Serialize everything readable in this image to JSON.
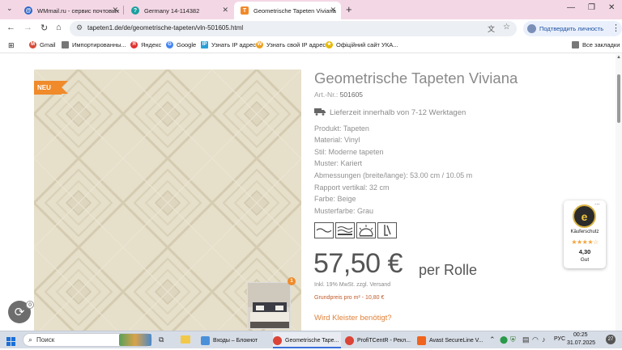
{
  "browser": {
    "tabs": [
      {
        "title": "WMmail.ru - сервис почтовых",
        "favicon_color": "#2a66c9",
        "active": false
      },
      {
        "title": "Germany 14-114382",
        "favicon_color": "#1aa0a0",
        "active": false
      },
      {
        "title": "Geometrische Tapeten Viviana",
        "favicon_color": "#f08a2a",
        "active": true
      }
    ],
    "new_tab_label": "+",
    "url": "tapeten1.de/de/geometrische-tapeten/vln-501605.html",
    "profile_chip": "Подтвердить личность",
    "bookmarks": [
      {
        "label": "Gmail",
        "color": "#d64a3a"
      },
      {
        "label": "Импортированны...",
        "color": "#777777"
      },
      {
        "label": "Яндекс",
        "color": "#e0322f"
      },
      {
        "label": "Google",
        "color": "#4285f4"
      },
      {
        "label": "Узнать IP адрес",
        "color": "#2a9fd6"
      },
      {
        "label": "Узнать свой IP адрес",
        "color": "#f0a020"
      },
      {
        "label": "Офіційний сайт УКА...",
        "color": "#e6b800"
      }
    ],
    "all_bookmarks": "Все закладки"
  },
  "product": {
    "badge": "NEU",
    "title": "Geometrische Tapeten Viviana",
    "art_label": "Art.-Nr.:",
    "art_value": "501605",
    "delivery": "Lieferzeit innerhalb von 7-12 Werktagen",
    "specs": [
      "Produkt: Tapeten",
      "Material: Vinyl",
      "Stil: Moderne tapeten",
      "Muster: Kariert",
      "Abmessungen (breite/lange): 53.00 cm / 10.05 m",
      "Rapport vertikal: 32 cm",
      "Farbe: Beige",
      "Musterfarbe: Grau"
    ],
    "feature_icons": [
      "wave-icon",
      "water-resistant-icon",
      "light-fastness-icon",
      "paste-wall-icon"
    ],
    "price": "57,50 €",
    "per_unit": "per Rolle",
    "vat_note": "Inkl. 19% MwSt. zzgl. Versand",
    "base_price": "Grundpreis pro m² - 10,80 €",
    "paste_link": "Wird Kleister benötigt?",
    "thumb_badge": "1"
  },
  "trust_badge": {
    "seal": "e",
    "label": "Käuferschutz",
    "stars": "★★★★☆",
    "score": "4,30",
    "rating_word": "Gut",
    "more": "..."
  },
  "floating": {
    "count": "0"
  },
  "taskbar": {
    "search_placeholder": "Поиск",
    "items": [
      {
        "label": "Входы – Блокнот",
        "color": "#4a90d9"
      },
      {
        "label": "Geometrische Tape...",
        "color": "#db4437"
      },
      {
        "label": "ProfiTCentR - Рекл...",
        "color": "#db4437"
      },
      {
        "label": "Avast SecureLine V...",
        "color": "#f0641e"
      }
    ],
    "language": "РУС",
    "time": "00:25",
    "date": "31.07.2025"
  }
}
